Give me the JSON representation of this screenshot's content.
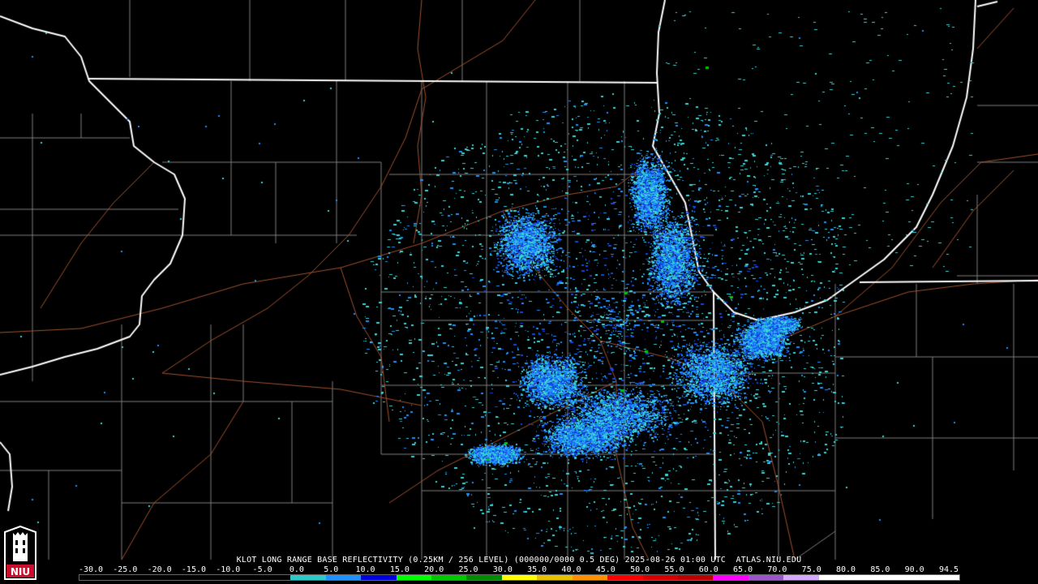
{
  "title": "KLOT LONG RANGE BASE REFLECTIVITY (0.25KM / 256 LEVEL) (000000/0000 0.5 DEG) 2025-08-26 01:00 UTC  ATLAS.NIU.EDU",
  "logo": {
    "text": "NIU",
    "colors": {
      "red": "#c8102e",
      "white": "#ffffff",
      "black": "#000000"
    }
  },
  "colorbar": {
    "labels": [
      "-30.0",
      "-25.0",
      "-20.0",
      "-15.0",
      "-10.0",
      "-5.0",
      "0.0",
      "5.0",
      "10.0",
      "15.0",
      "20.0",
      "25.0",
      "30.0",
      "35.0",
      "40.0",
      "45.0",
      "50.0",
      "55.0",
      "60.0",
      "65.0",
      "70.0",
      "75.0",
      "80.0",
      "85.0",
      "90.0",
      "94.5"
    ],
    "colors": [
      "#000000",
      "#000000",
      "#000000",
      "#000000",
      "#000000",
      "#000000",
      "#2ec8c8",
      "#1e90ff",
      "#0000dd",
      "#00ff00",
      "#00c800",
      "#008c00",
      "#ffff00",
      "#e7c000",
      "#ff9000",
      "#ff0000",
      "#d60000",
      "#c00000",
      "#ff00ff",
      "#9955c9",
      "#d8a8ff",
      "#ffffff",
      "#ffffff",
      "#ffffff",
      "#ffffff"
    ]
  },
  "map_colors": {
    "background": "#000000",
    "state_border": "#ffffff",
    "county_border": "#7f7f7f",
    "highway": "#a0522d",
    "echo_light": "#3ad4d4",
    "echo_mid": "#1e90ff",
    "echo_dense": "#1646e0",
    "echo_green": "#00c800"
  }
}
